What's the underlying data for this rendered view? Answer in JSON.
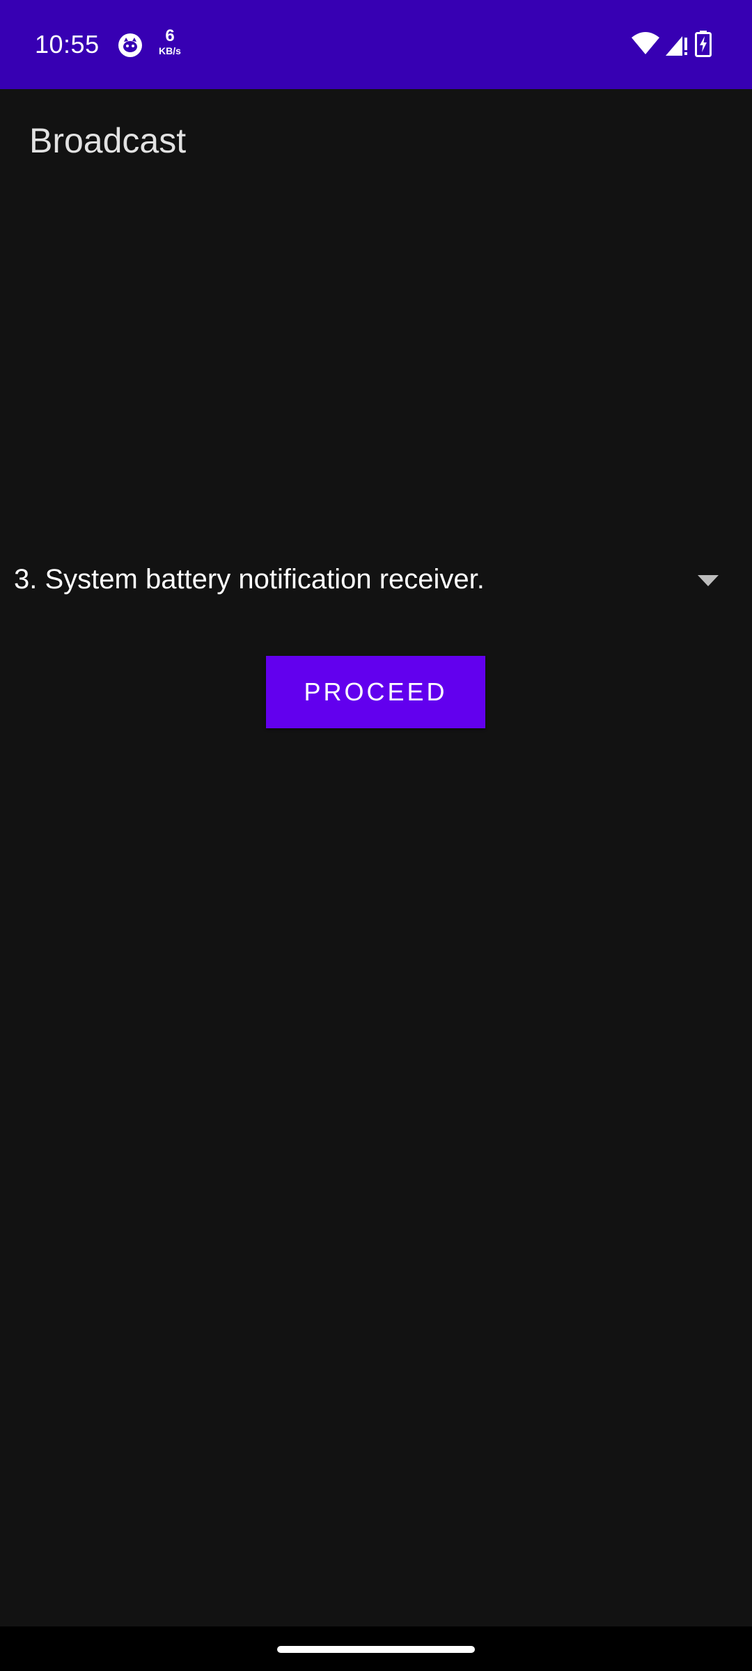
{
  "status_bar": {
    "time": "10:55",
    "net_speed_value": "6",
    "net_speed_unit": "KB/s",
    "app_icon": "cat-face-icon",
    "icons": [
      "wifi-icon",
      "signal-alert-icon",
      "battery-charging-icon"
    ]
  },
  "app_bar": {
    "title": "Broadcast"
  },
  "spinner": {
    "selected": "3. System battery notification receiver.",
    "icon": "dropdown-triangle-icon"
  },
  "actions": {
    "proceed_label": "PROCEED"
  },
  "colors": {
    "status_bar": "#3700B3",
    "primary": "#6200EE",
    "background": "#121212"
  }
}
